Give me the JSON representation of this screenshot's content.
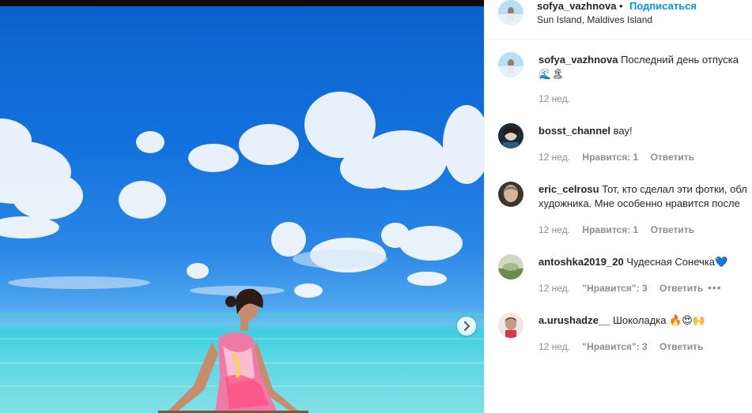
{
  "post": {
    "username": "sofya_vazhnova",
    "separator": "•",
    "follow_label": "Подписаться",
    "location": "Sun Island, Maldives Island"
  },
  "caption": {
    "username": "sofya_vazhnova",
    "text_line1": "Последний день отпуска",
    "text_line2": "🌊🏝",
    "time": "12 нед."
  },
  "comments": [
    {
      "username": "bosst_channel",
      "text": "вау!",
      "time": "12 нед.",
      "likes": "Нравится: 1",
      "reply": "Ответить"
    },
    {
      "username": "eric_celrosu",
      "text": "Тот, кто сделал эти фотки, обл",
      "text_line2": "художника. Мне особенно нравится после",
      "time": "12 нед.",
      "likes": "Нравится: 1",
      "reply": "Ответить"
    },
    {
      "username": "antoshka2019_20",
      "text": "Чудесная Сонечка💙",
      "time": "12 нед.",
      "likes": "\"Нравится\": 3",
      "reply": "Ответить",
      "more": "•••"
    },
    {
      "username": "a.urushadze__",
      "text": "Шоколадка 🔥😍🙌",
      "time": "12 нед.",
      "likes": "\"Нравится\": 3",
      "reply": "Ответить"
    }
  ],
  "icons": {
    "next": "chevron-right-icon"
  }
}
